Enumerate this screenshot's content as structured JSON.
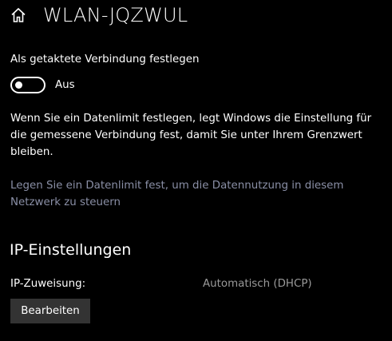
{
  "header": {
    "home_icon": "home-icon",
    "title": "WLAN-JQZWUL"
  },
  "metered": {
    "label": "Als getaktete Verbindung festlegen",
    "toggle_state_label": "Aus",
    "toggle_on": false
  },
  "description": "Wenn Sie ein Datenlimit festlegen, legt Windows die Einstellung für die gemessene Verbindung fest, damit Sie unter Ihrem Grenzwert bleiben.",
  "data_limit_link": "Legen Sie ein Datenlimit fest, um die Datennutzung in diesem Netzwerk zu steuern",
  "ip_settings": {
    "title": "IP-Einstellungen",
    "assignment_label": "IP-Zuweisung:",
    "assignment_value": "Automatisch (DHCP)",
    "edit_button_label": "Bearbeiten"
  },
  "colors": {
    "background": "#000000",
    "text": "#ffffff",
    "link": "#8a8fa6",
    "secondary_text": "#9a9a9a",
    "button_background": "#333333"
  }
}
